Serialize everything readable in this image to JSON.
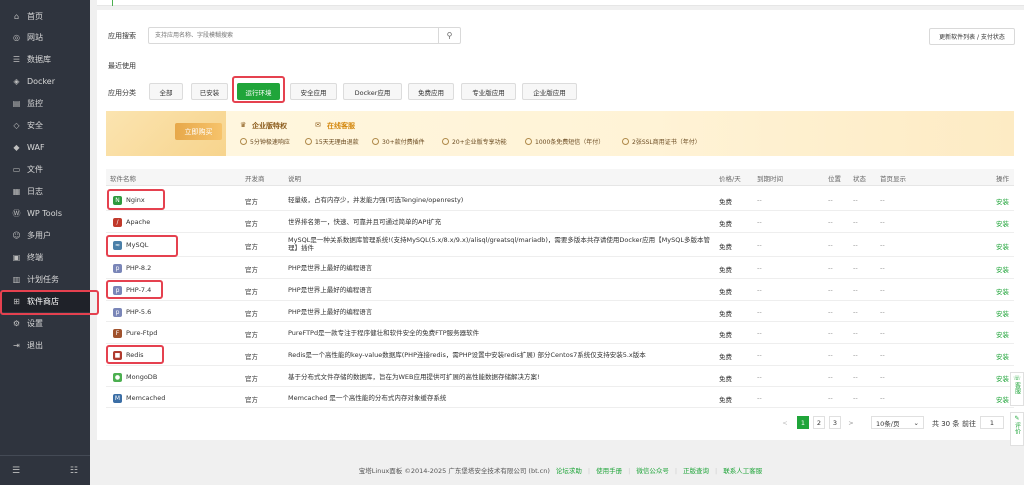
{
  "sidebar": {
    "items": [
      {
        "label": "首页",
        "icon": "home-icon",
        "glyph": "⌂"
      },
      {
        "label": "网站",
        "icon": "globe-icon",
        "glyph": "◎"
      },
      {
        "label": "数据库",
        "icon": "database-icon",
        "glyph": "☰"
      },
      {
        "label": "Docker",
        "icon": "docker-icon",
        "glyph": "◈"
      },
      {
        "label": "监控",
        "icon": "monitor-icon",
        "glyph": "▤"
      },
      {
        "label": "安全",
        "icon": "shield-icon",
        "glyph": "◇"
      },
      {
        "label": "WAF",
        "icon": "waf-icon",
        "glyph": "◆"
      },
      {
        "label": "文件",
        "icon": "folder-icon",
        "glyph": "▭"
      },
      {
        "label": "日志",
        "icon": "log-icon",
        "glyph": "▦"
      },
      {
        "label": "WP Tools",
        "icon": "wordpress-icon",
        "glyph": "Ⓦ"
      },
      {
        "label": "多用户",
        "icon": "users-icon",
        "glyph": "☺"
      },
      {
        "label": "终端",
        "icon": "terminal-icon",
        "glyph": "▣"
      },
      {
        "label": "计划任务",
        "icon": "calendar-icon",
        "glyph": "▥"
      },
      {
        "label": "软件商店",
        "icon": "apps-icon",
        "glyph": "⊞"
      },
      {
        "label": "设置",
        "icon": "gear-icon",
        "glyph": "⚙"
      },
      {
        "label": "退出",
        "icon": "logout-icon",
        "glyph": "⇥"
      }
    ]
  },
  "search": {
    "label": "应用搜索",
    "placeholder": "支持应用名称、字段模糊搜索",
    "update_btn": "更新软件列表 / 支付状态"
  },
  "recent_label": "最近使用",
  "category_label": "应用分类",
  "categories": [
    "全部",
    "已安装",
    "运行环境",
    "安全应用",
    "Docker应用",
    "免费应用",
    "专业版应用",
    "企业版应用"
  ],
  "banner": {
    "buy": "立即购买",
    "privilege": "企业版特权",
    "service": "在线客服",
    "features": [
      "5分钟极速响应",
      "15天无理由退款",
      "30+款付费插件",
      "20+企业版专享功能",
      "1000条免费短信（年付）",
      "2张SSL商用证书（年付）"
    ]
  },
  "table": {
    "headers": [
      "软件名称",
      "开发商",
      "说明",
      "价格/天",
      "到期时间",
      "位置",
      "状态",
      "首页显示",
      "操作"
    ],
    "rows": [
      {
        "name": "Nginx",
        "dev": "官方",
        "desc": "轻量级，占有内存少，并发能力强(可选Tengine/openresty)",
        "price": "免费",
        "expire": "--",
        "pos": "--",
        "status": "--",
        "home": "--",
        "action": "安装",
        "icon_color": "#2e9a3e",
        "glyph": "N"
      },
      {
        "name": "Apache",
        "dev": "官方",
        "desc": "世界排名第一，快速、可靠并且可通过简单的API扩充",
        "price": "免费",
        "expire": "--",
        "pos": "--",
        "status": "--",
        "home": "--",
        "action": "安装",
        "icon_color": "#c0392b",
        "glyph": "/"
      },
      {
        "name": "MySQL",
        "dev": "官方",
        "desc": "MySQL是一种关系数据库管理系统!(支持MySQL(5.x/8.x/9.x)/alisql/greatsql/mariadb)，需要多版本共存请使用Docker应用【MySQL多版本管理】插件",
        "price": "免费",
        "expire": "--",
        "pos": "--",
        "status": "--",
        "home": "--",
        "action": "安装",
        "icon_color": "#4a7fa8",
        "glyph": "≈"
      },
      {
        "name": "PHP-8.2",
        "dev": "官方",
        "desc": "PHP是世界上最好的编程语言",
        "price": "免费",
        "expire": "--",
        "pos": "--",
        "status": "--",
        "home": "--",
        "action": "安装",
        "icon_color": "#7a86b8",
        "glyph": "p"
      },
      {
        "name": "PHP-7.4",
        "dev": "官方",
        "desc": "PHP是世界上最好的编程语言",
        "price": "免费",
        "expire": "--",
        "pos": "--",
        "status": "--",
        "home": "--",
        "action": "安装",
        "icon_color": "#7a86b8",
        "glyph": "p"
      },
      {
        "name": "PHP-5.6",
        "dev": "官方",
        "desc": "PHP是世界上最好的编程语言",
        "price": "免费",
        "expire": "--",
        "pos": "--",
        "status": "--",
        "home": "--",
        "action": "安装",
        "icon_color": "#7a86b8",
        "glyph": "p"
      },
      {
        "name": "Pure-Ftpd",
        "dev": "官方",
        "desc": "PureFTPd是一款专注于程序健壮和软件安全的免费FTP服务器软件",
        "price": "免费",
        "expire": "--",
        "pos": "--",
        "status": "--",
        "home": "--",
        "action": "安装",
        "icon_color": "#a0522d",
        "glyph": "F"
      },
      {
        "name": "Redis",
        "dev": "官方",
        "desc": "Redis是一个高性能的key-value数据库(PHP连接redis，需PHP设置中安装redis扩展) 部分Centos7系统仅支持安装5.x版本",
        "price": "免费",
        "expire": "--",
        "pos": "--",
        "status": "--",
        "home": "--",
        "action": "安装",
        "icon_color": "#b03a2e",
        "glyph": "■"
      },
      {
        "name": "MongoDB",
        "dev": "官方",
        "desc": "基于分布式文件存储的数据库，旨在为WEB应用提供可扩展的高性能数据存储解决方案!",
        "price": "免费",
        "expire": "--",
        "pos": "--",
        "status": "--",
        "home": "--",
        "action": "安装",
        "icon_color": "#4caf50",
        "glyph": "●"
      },
      {
        "name": "Memcached",
        "dev": "官方",
        "desc": "Memcached 是一个高性能的分布式内存对象缓存系统",
        "price": "免费",
        "expire": "--",
        "pos": "--",
        "status": "--",
        "home": "--",
        "action": "安装",
        "icon_color": "#3b6ea5",
        "glyph": "M"
      }
    ]
  },
  "pagination": {
    "prev": "<",
    "pages": [
      "1",
      "2",
      "3"
    ],
    "next": ">",
    "per_page": "10条/页",
    "total": "共 30 条",
    "goto": "前往",
    "page_input": "1"
  },
  "footer": {
    "copyright": "宝塔Linux面板 ©2014-2025 广东堡塔安全技术有限公司 (bt.cn)",
    "links": [
      "论坛求助",
      "使用手册",
      "微信公众号",
      "正版查询",
      "联系人工客服"
    ]
  },
  "float": {
    "service": "客服",
    "review": "评价"
  }
}
